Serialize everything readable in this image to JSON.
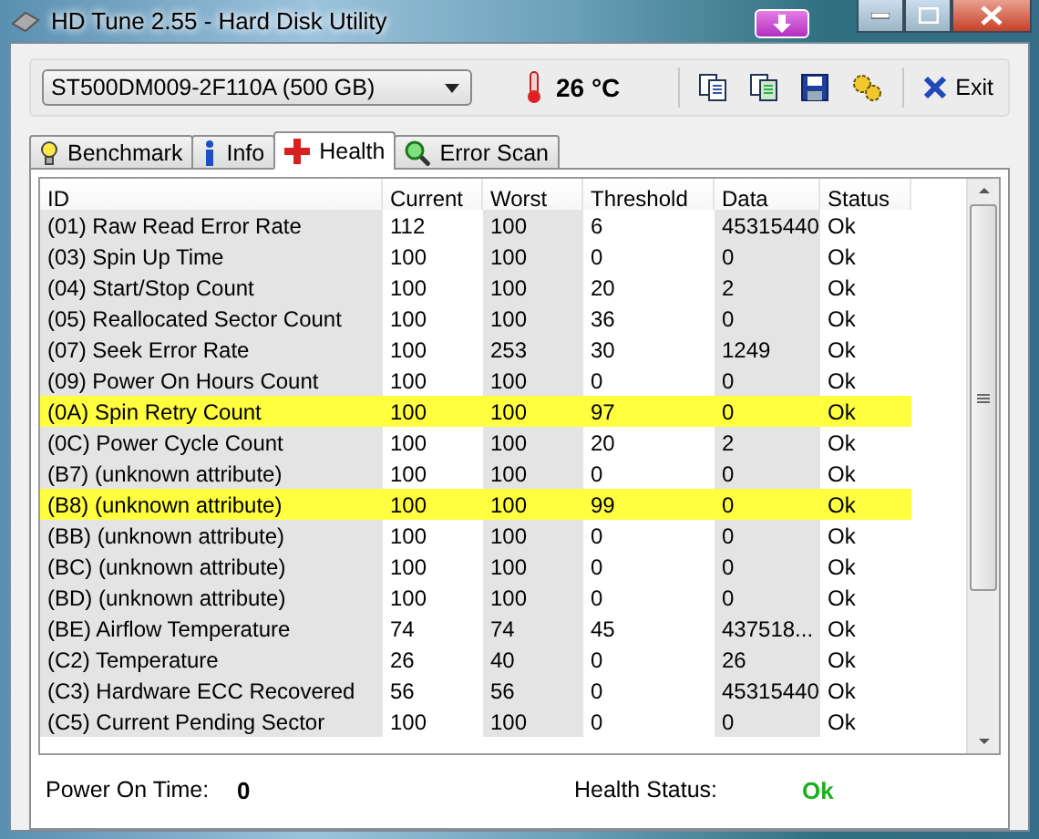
{
  "window": {
    "title": "HD Tune 2.55 - Hard Disk Utility"
  },
  "toolbar": {
    "drive": "ST500DM009-2F110A (500 GB)",
    "temperature": "26 °C",
    "exit": "Exit"
  },
  "tabs": [
    {
      "label": "Benchmark",
      "selected": false
    },
    {
      "label": "Info",
      "selected": false
    },
    {
      "label": "Health",
      "selected": true
    },
    {
      "label": "Error Scan",
      "selected": false
    }
  ],
  "table": {
    "columns": [
      "ID",
      "Current",
      "Worst",
      "Threshold",
      "Data",
      "Status"
    ],
    "rows": [
      {
        "cells": [
          "(01) Raw Read Error Rate",
          "112",
          "100",
          "6",
          "45315440",
          "Ok"
        ],
        "highlighted": false
      },
      {
        "cells": [
          "(03) Spin Up Time",
          "100",
          "100",
          "0",
          "0",
          "Ok"
        ],
        "highlighted": false
      },
      {
        "cells": [
          "(04) Start/Stop Count",
          "100",
          "100",
          "20",
          "2",
          "Ok"
        ],
        "highlighted": false
      },
      {
        "cells": [
          "(05) Reallocated Sector Count",
          "100",
          "100",
          "36",
          "0",
          "Ok"
        ],
        "highlighted": false
      },
      {
        "cells": [
          "(07) Seek Error Rate",
          "100",
          "253",
          "30",
          "1249",
          "Ok"
        ],
        "highlighted": false
      },
      {
        "cells": [
          "(09) Power On Hours Count",
          "100",
          "100",
          "0",
          "0",
          "Ok"
        ],
        "highlighted": false
      },
      {
        "cells": [
          "(0A) Spin Retry Count",
          "100",
          "100",
          "97",
          "0",
          "Ok"
        ],
        "highlighted": true
      },
      {
        "cells": [
          "(0C) Power Cycle Count",
          "100",
          "100",
          "20",
          "2",
          "Ok"
        ],
        "highlighted": false
      },
      {
        "cells": [
          "(B7) (unknown attribute)",
          "100",
          "100",
          "0",
          "0",
          "Ok"
        ],
        "highlighted": false
      },
      {
        "cells": [
          "(B8) (unknown attribute)",
          "100",
          "100",
          "99",
          "0",
          "Ok"
        ],
        "highlighted": true
      },
      {
        "cells": [
          "(BB) (unknown attribute)",
          "100",
          "100",
          "0",
          "0",
          "Ok"
        ],
        "highlighted": false
      },
      {
        "cells": [
          "(BC) (unknown attribute)",
          "100",
          "100",
          "0",
          "0",
          "Ok"
        ],
        "highlighted": false
      },
      {
        "cells": [
          "(BD) (unknown attribute)",
          "100",
          "100",
          "0",
          "0",
          "Ok"
        ],
        "highlighted": false
      },
      {
        "cells": [
          "(BE) Airflow Temperature",
          "74",
          "74",
          "45",
          "437518...",
          "Ok"
        ],
        "highlighted": false
      },
      {
        "cells": [
          "(C2) Temperature",
          "26",
          "40",
          "0",
          "26",
          "Ok"
        ],
        "highlighted": false
      },
      {
        "cells": [
          "(C3) Hardware ECC Recovered",
          "56",
          "56",
          "0",
          "45315440",
          "Ok"
        ],
        "highlighted": false
      },
      {
        "cells": [
          "(C5) Current Pending Sector",
          "100",
          "100",
          "0",
          "0",
          "Ok"
        ],
        "highlighted": false
      }
    ]
  },
  "footer": {
    "power_label": "Power On Time:",
    "power_value": "0",
    "health_label": "Health Status:",
    "health_value": "Ok"
  }
}
